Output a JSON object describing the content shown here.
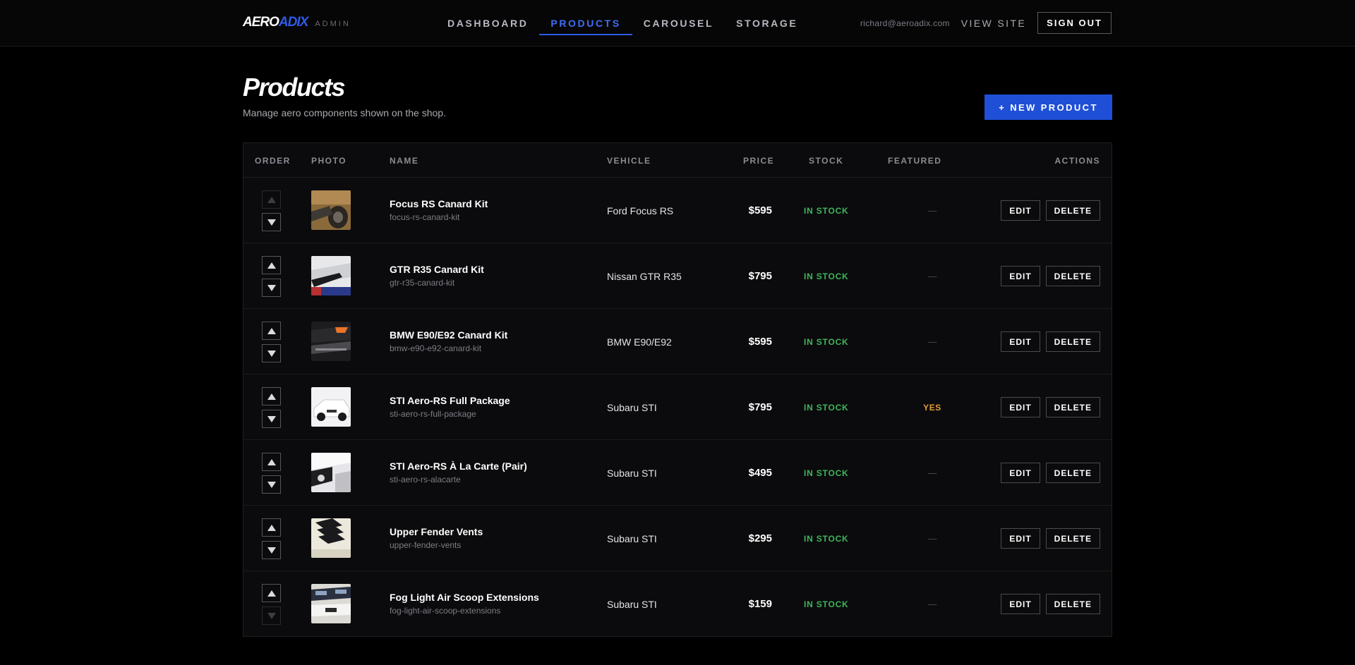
{
  "header": {
    "logo_part1": "AERO",
    "logo_part2": "ADIX",
    "admin_label": "ADMIN",
    "nav": [
      "DASHBOARD",
      "PRODUCTS",
      "CAROUSEL",
      "STORAGE"
    ],
    "active_nav": "PRODUCTS",
    "email": "richard@aeroadix.com",
    "view_site": "VIEW SITE",
    "sign_out": "SIGN OUT"
  },
  "page": {
    "title": "Products",
    "subtitle": "Manage aero components shown on the shop.",
    "new_button": "+ NEW PRODUCT"
  },
  "table": {
    "columns": {
      "order": "ORDER",
      "photo": "PHOTO",
      "name": "NAME",
      "vehicle": "VEHICLE",
      "price": "PRICE",
      "stock": "STOCK",
      "featured": "FEATURED",
      "actions": "ACTIONS"
    },
    "edit_label": "EDIT",
    "delete_label": "DELETE",
    "rows": [
      {
        "name": "Focus RS Canard Kit",
        "slug": "focus-rs-canard-kit",
        "vehicle": "Ford Focus RS",
        "price": "$595",
        "stock": "IN STOCK",
        "featured": "—",
        "up_disabled": true,
        "down_disabled": false
      },
      {
        "name": "GTR R35 Canard Kit",
        "slug": "gtr-r35-canard-kit",
        "vehicle": "Nissan GTR R35",
        "price": "$795",
        "stock": "IN STOCK",
        "featured": "—",
        "up_disabled": false,
        "down_disabled": false
      },
      {
        "name": "BMW E90/E92 Canard Kit",
        "slug": "bmw-e90-e92-canard-kit",
        "vehicle": "BMW E90/E92",
        "price": "$595",
        "stock": "IN STOCK",
        "featured": "—",
        "up_disabled": false,
        "down_disabled": false
      },
      {
        "name": "STI Aero-RS Full Package",
        "slug": "sti-aero-rs-full-package",
        "vehicle": "Subaru STI",
        "price": "$795",
        "stock": "IN STOCK",
        "featured": "YES",
        "up_disabled": false,
        "down_disabled": false
      },
      {
        "name": "STI Aero-RS À La Carte (Pair)",
        "slug": "sti-aero-rs-alacarte",
        "vehicle": "Subaru STI",
        "price": "$495",
        "stock": "IN STOCK",
        "featured": "—",
        "up_disabled": false,
        "down_disabled": false
      },
      {
        "name": "Upper Fender Vents",
        "slug": "upper-fender-vents",
        "vehicle": "Subaru STI",
        "price": "$295",
        "stock": "IN STOCK",
        "featured": "—",
        "up_disabled": false,
        "down_disabled": false
      },
      {
        "name": "Fog Light Air Scoop Extensions",
        "slug": "fog-light-air-scoop-extensions",
        "vehicle": "Subaru STI",
        "price": "$159",
        "stock": "IN STOCK",
        "featured": "—",
        "up_disabled": false,
        "down_disabled": true
      }
    ]
  },
  "colors": {
    "accent": "#2f5be8",
    "in_stock": "#3fb55c",
    "featured_yes": "#e39b3a"
  }
}
